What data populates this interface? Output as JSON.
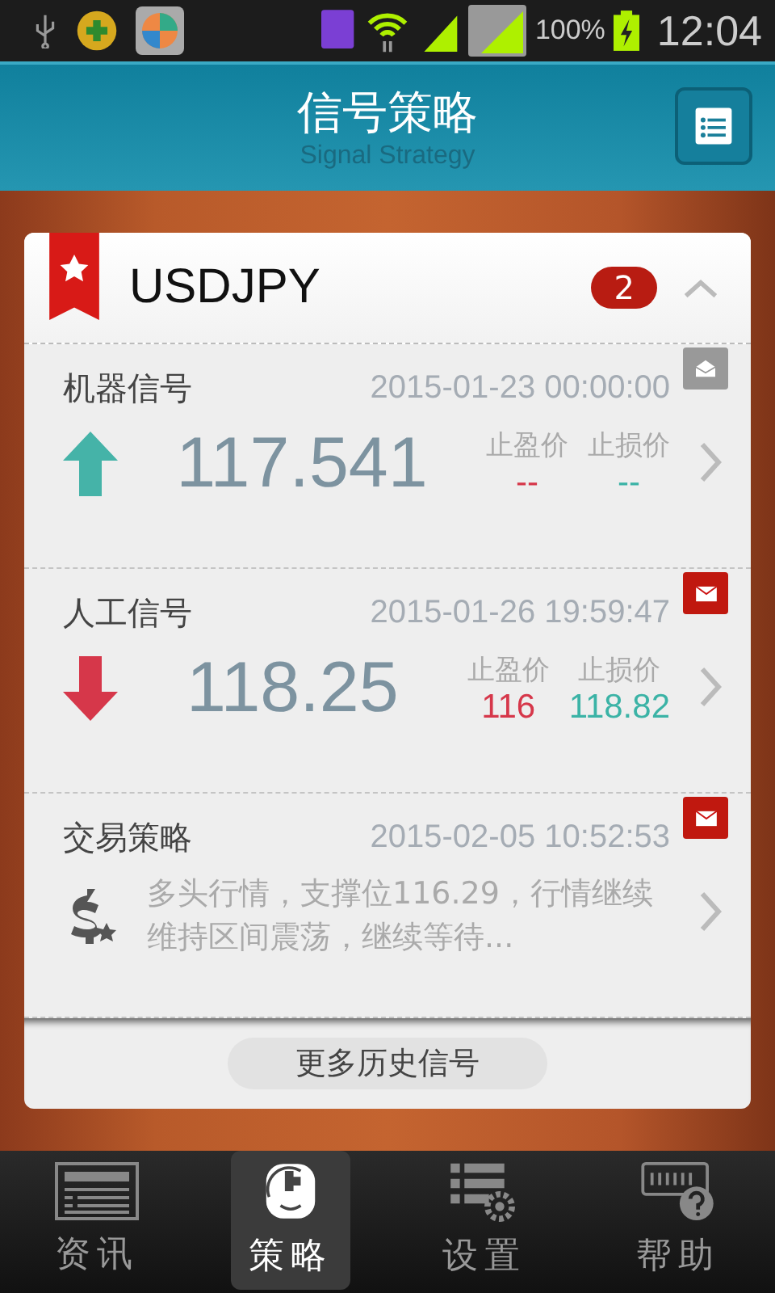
{
  "status_bar": {
    "battery": "100%",
    "time": "12:04"
  },
  "header": {
    "title": "信号策略",
    "subtitle": "Signal Strategy"
  },
  "panel": {
    "symbol": "USDJPY",
    "count": "2",
    "expanded": true
  },
  "signals": [
    {
      "kind": "machine",
      "title": "机器信号",
      "time": "2015-01-23 00:00:00",
      "read": true,
      "rising": true,
      "price": "117.541",
      "tp_label": "止盈价",
      "sl_label": "止损价",
      "tp": "--",
      "sl": "--"
    },
    {
      "kind": "manual",
      "title": "人工信号",
      "time": "2015-01-26 19:59:47",
      "read": false,
      "rising": false,
      "price": "118.25",
      "tp_label": "止盈价",
      "sl_label": "止损价",
      "tp": "116",
      "sl": "118.82"
    },
    {
      "kind": "strategy",
      "title": "交易策略",
      "time": "2015-02-05 10:52:53",
      "read": false,
      "text": "多头行情，支撑位116.29，行情继续维持区间震荡，继续等待..."
    }
  ],
  "more_button": "更多历史信号",
  "tabs": [
    {
      "kind": "news",
      "label": "资讯",
      "selected": false
    },
    {
      "kind": "face",
      "label": "策略",
      "selected": true
    },
    {
      "kind": "settings",
      "label": "设置",
      "selected": false
    },
    {
      "kind": "help",
      "label": "帮助",
      "selected": false
    }
  ]
}
